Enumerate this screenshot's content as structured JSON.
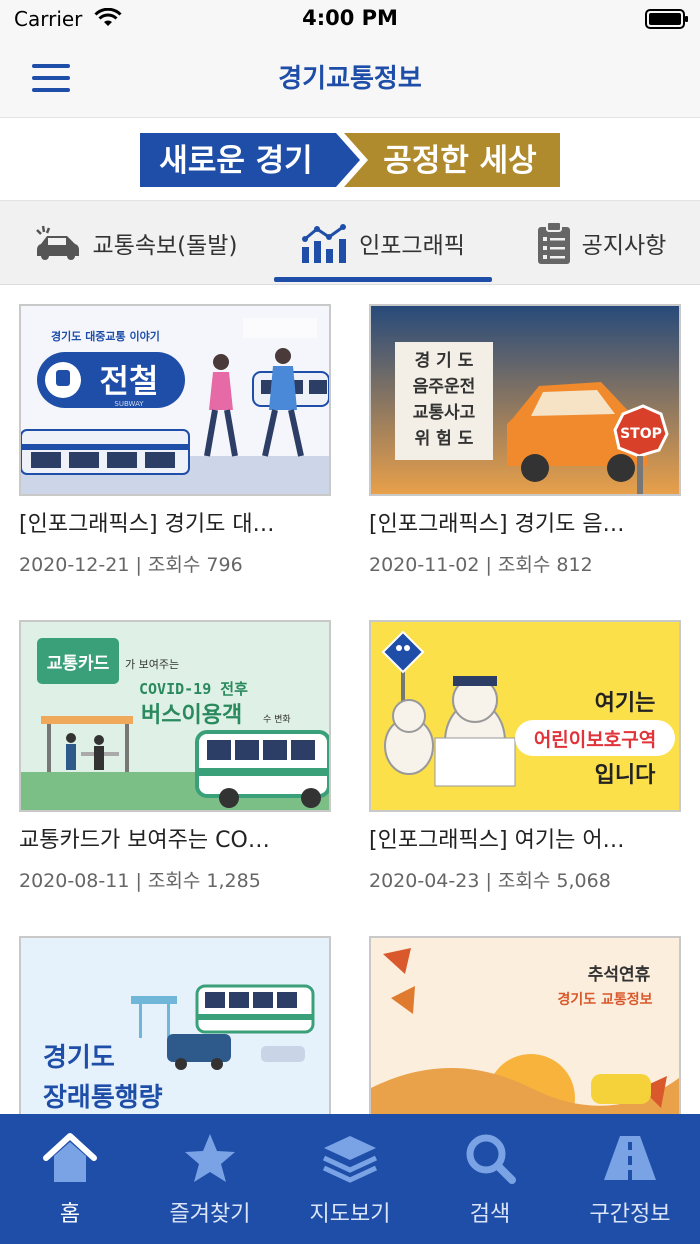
{
  "status_bar": {
    "carrier": "Carrier",
    "time": "4:00 PM"
  },
  "header": {
    "title": "경기교통정보"
  },
  "banner": {
    "left_text": "새로운 경기",
    "right_text": "공정한 세상"
  },
  "tabs": [
    {
      "label": "교통속보(돌발)",
      "icon": "car-alert-icon",
      "selected": false
    },
    {
      "label": "인포그래픽",
      "icon": "bar-chart-icon",
      "selected": true
    },
    {
      "label": "공지사항",
      "icon": "clipboard-icon",
      "selected": false
    }
  ],
  "accent_color": "#1f4ea8",
  "cards": [
    {
      "title": "[인포그래픽스] 경기도 대…",
      "date": "2020-12-21",
      "views_label": "조회수",
      "views": "796",
      "thumb": {
        "caption": "경기도 대중교통 이야기",
        "word": "전철",
        "sub": "SUBWAY"
      }
    },
    {
      "title": "[인포그래픽스] 경기도 음…",
      "date": "2020-11-02",
      "views_label": "조회수",
      "views": "812",
      "thumb": {
        "lines": [
          "경 기 도",
          "음주운전",
          "교통사고",
          "위 험 도"
        ],
        "sign": "STOP"
      }
    },
    {
      "title": "교통카드가 보여주는 CO…",
      "date": "2020-08-11",
      "views_label": "조회수",
      "views": "1,285",
      "thumb": {
        "card": "교통카드",
        "small": "가 보여주는",
        "covid": "COVID-19 전후",
        "big": "버스이용객",
        "tail": "수 변화"
      }
    },
    {
      "title": "[인포그래픽스] 여기는 어…",
      "date": "2020-04-23",
      "views_label": "조회수",
      "views": "5,068",
      "thumb": {
        "line1": "여기는",
        "line2": "어린이보호구역",
        "line3": "입니다"
      }
    },
    {
      "title": "",
      "date": "",
      "views_label": "",
      "views": "",
      "thumb": {
        "line1": "경기도",
        "line2": "장래통행량"
      }
    },
    {
      "title": "",
      "date": "",
      "views_label": "",
      "views": "",
      "thumb": {
        "line1": "추석연휴",
        "line2": "경기도 교통정보"
      }
    }
  ],
  "bottom_nav": [
    {
      "label": "홈",
      "icon": "home-icon",
      "active": true
    },
    {
      "label": "즐겨찾기",
      "icon": "star-icon",
      "active": false
    },
    {
      "label": "지도보기",
      "icon": "layers-icon",
      "active": false
    },
    {
      "label": "검색",
      "icon": "search-icon",
      "active": false
    },
    {
      "label": "구간정보",
      "icon": "road-icon",
      "active": false
    }
  ]
}
